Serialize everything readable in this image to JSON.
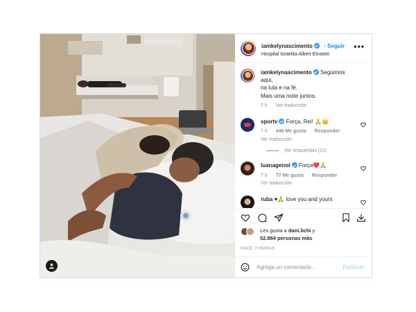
{
  "post": {
    "author": "iamkelynascimento",
    "follow_label": "Seguir",
    "location": "Hospital Israelita Albert Einstein",
    "more_label": "•••",
    "caption_lines": [
      "Seguimos aqui,",
      "na luta e na fé.",
      "Mais uma noite juntos."
    ],
    "caption_time": "7 h",
    "caption_translation": "Ver traducción"
  },
  "comments": [
    {
      "user": "sportv",
      "text": "Força, Rei! 🙏👑",
      "time": "7 h",
      "likes": "446 Me gusta",
      "reply": "Responder",
      "translation": "Ver traducción",
      "view_replies": "Ver respuestas (21)"
    },
    {
      "user": "luanagenot",
      "text": "Força❤️🙏",
      "time": "7 h",
      "likes": "77 Me gusta",
      "reply": "Responder",
      "translation": "Ver traducción"
    },
    {
      "user": "ruba",
      "text": "♥🙏 love you and yours"
    }
  ],
  "likes": {
    "prefix": "Les gusta a",
    "user": "dani.lichi",
    "conj": "y",
    "count": "52.884 personas más"
  },
  "timestamp": "HACE 7 HORAS",
  "add_comment": {
    "placeholder": "Agrega un comentario...",
    "publish_label": "Publicar"
  },
  "icons": [
    "heart-icon",
    "comment-icon",
    "share-icon",
    "bookmark-icon",
    "download-icon",
    "emoji-icon",
    "user-tag-icon",
    "verified-badge-icon",
    "more-icon"
  ],
  "colors": {
    "link_blue": "#0095f6",
    "verified_blue": "#3897f0",
    "muted": "#8e8e8e",
    "publish_disabled": "#b2dffc"
  }
}
